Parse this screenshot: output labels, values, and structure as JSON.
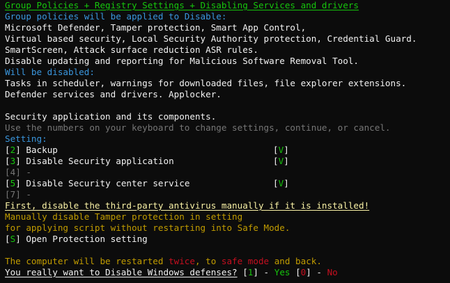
{
  "header": "Group Policies + Registry Settings + Disabling Services and drivers",
  "policies": {
    "title": "Group policies will be applied to Disable:",
    "lines": [
      "Microsoft Defender, Tamper protection, Smart App Control,",
      "Virtual based security, Local Security Authority protection, Credential Guard.",
      "SmartScreen, Attack surface reduction ASR rules.",
      "Disable updating and reporting for Malicious Software Removal Tool."
    ]
  },
  "disabled": {
    "title": "Will be disabled:",
    "lines": [
      "Tasks in scheduler, warnings for downloaded files, file explorer extensions.",
      "Defender services and drivers. Applocker."
    ]
  },
  "security_app": "Security application and its components.",
  "instructions": "Use the numbers on your keyboard to change settings, continue, or cancel.",
  "settings_title": "Setting:",
  "settings": [
    {
      "key": "2",
      "label": "Backup",
      "state": "V"
    },
    {
      "key": "3",
      "label": "Disable Security application",
      "state": "V"
    },
    {
      "key": "4",
      "label": "-",
      "state": ""
    },
    {
      "key": "5",
      "label": "Disable Security center service",
      "state": "V"
    },
    {
      "key": "7",
      "label": "-",
      "state": ""
    }
  ],
  "warning": "First, disable the third-party antivirus manually if it is installed!",
  "tamper": {
    "line1": "Manually disable Tamper protection in setting",
    "line2": "for applying script without restarting into Safe Mode."
  },
  "open_protection": {
    "key": "S",
    "label": "Open Protection setting"
  },
  "restart": {
    "pre": "The computer will be restarted ",
    "twice": "twice",
    "mid": ", to ",
    "safe_mode": "safe mode",
    "post": " and back."
  },
  "prompt": {
    "question": "You really want to Disable Windows defenses?",
    "yes_key": "1",
    "yes_label": "Yes",
    "no_key": "0",
    "no_label": "No"
  },
  "colors": {
    "background": "#0c0c0c",
    "green": "#16c60c",
    "cyan": "#3a96dd",
    "gray": "#767676",
    "yellow": "#c19c00",
    "bright_yellow": "#f9f1a5",
    "red": "#c50f1f"
  }
}
